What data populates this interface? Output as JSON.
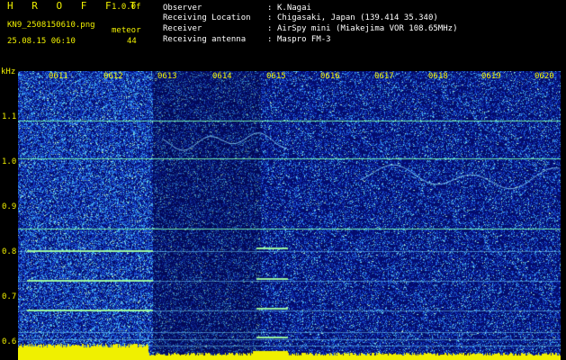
{
  "header": {
    "app_title": "H R O F F T",
    "version": "1.0.0f",
    "filename": "KN9_2508150610.png",
    "mode": "meteor",
    "count": "44",
    "datetime": "25.08.15 06:10",
    "fields": [
      {
        "key": "Observer",
        "value": "K.Nagai"
      },
      {
        "key": "Receiving Location",
        "value": "Chigasaki, Japan (139.414 35.340)"
      },
      {
        "key": "Receiver",
        "value": "AirSpy mini (Miakejima VOR 108.65MHz)"
      },
      {
        "key": "Receiving antenna",
        "value": "Maspro FM-3"
      }
    ]
  },
  "axes": {
    "y_unit": "kHz",
    "x_ticks": [
      "0611",
      "0612",
      "0613",
      "0614",
      "0615",
      "0616",
      "0617",
      "0618",
      "0619",
      "0620"
    ],
    "y_ticks": [
      "1.1",
      "1.0",
      "0.9",
      "0.8",
      "0.7",
      "0.6"
    ]
  },
  "colors": {
    "background": "#000000",
    "label": "#f0f000",
    "text": "#ffffff",
    "noise_base": "#0a1a8a",
    "trace": "#7fffa0",
    "baseline_bar": "#f0f000"
  }
}
